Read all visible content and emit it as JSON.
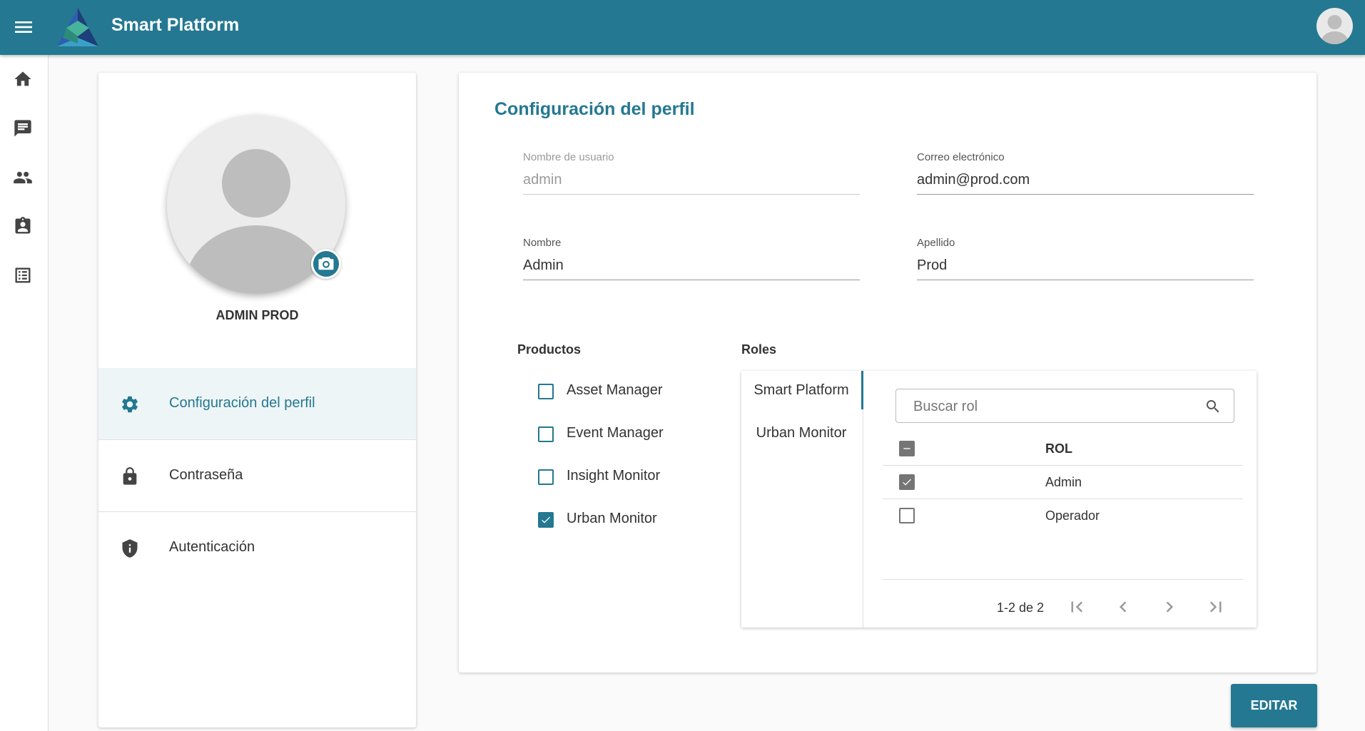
{
  "header": {
    "app_title": "Smart Platform",
    "brand_color": "#247891"
  },
  "sidebar": {
    "items": [
      {
        "icon": "home-icon"
      },
      {
        "icon": "chat-icon"
      },
      {
        "icon": "people-icon"
      },
      {
        "icon": "contact-clipboard-icon"
      },
      {
        "icon": "list-icon"
      }
    ]
  },
  "profile": {
    "name": "ADMIN PROD",
    "nav": [
      {
        "label": "Configuración del perfil",
        "icon": "gear-icon",
        "active": true
      },
      {
        "label": "Contraseña",
        "icon": "lock-icon",
        "active": false
      },
      {
        "label": "Autenticación",
        "icon": "shield-icon",
        "active": false
      }
    ]
  },
  "form": {
    "title": "Configuración del perfil",
    "username": {
      "label": "Nombre de usuario",
      "value": "admin"
    },
    "email": {
      "label": "Correo electrónico",
      "value": "admin@prod.com"
    },
    "first_name": {
      "label": "Nombre",
      "value": "Admin"
    },
    "last_name": {
      "label": "Apellido",
      "value": "Prod"
    }
  },
  "products": {
    "title": "Productos",
    "items": [
      {
        "label": "Asset Manager",
        "checked": false
      },
      {
        "label": "Event Manager",
        "checked": false
      },
      {
        "label": "Insight Monitor",
        "checked": false
      },
      {
        "label": "Urban Monitor",
        "checked": true
      }
    ]
  },
  "roles": {
    "title": "Roles",
    "tabs": [
      {
        "label": "Smart Platform",
        "active": true
      },
      {
        "label": "Urban Monitor",
        "active": false
      }
    ],
    "search_placeholder": "Buscar rol",
    "column_header": "ROL",
    "rows": [
      {
        "role": "Admin",
        "checked": true
      },
      {
        "role": "Operador",
        "checked": false
      }
    ],
    "range_label": "1-2 de 2"
  },
  "actions": {
    "edit_label": "EDITAR"
  }
}
